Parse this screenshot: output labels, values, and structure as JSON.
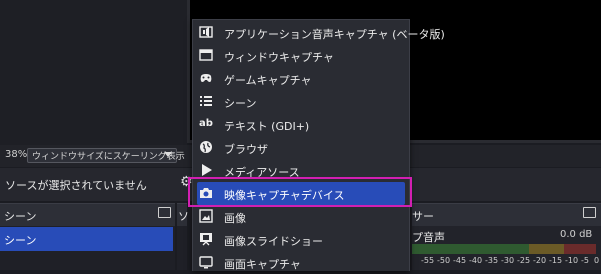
{
  "scale_bar": {
    "zoom": "38%",
    "mode": "ウィンドウサイズにスケーリング表示"
  },
  "source_bar": {
    "message": "ソースが選択されていません"
  },
  "scenes": {
    "title": "シーン",
    "items": [
      "シーン"
    ]
  },
  "sources": {
    "title_fragment": "ソ"
  },
  "mixer": {
    "title_fragment": "サー",
    "source_label": "プ音声",
    "level": "0.0 dB",
    "scale": [
      "-55",
      "-50",
      "-45",
      "-40",
      "-35",
      "-30",
      "-25",
      "-20",
      "-15",
      "-10",
      "-5",
      "0"
    ]
  },
  "menu": {
    "items": [
      {
        "label": "アプリケーション音声キャプチャ (ベータ版)",
        "icon": "app-audio-icon"
      },
      {
        "label": "ウィンドウキャプチャ",
        "icon": "window-icon"
      },
      {
        "label": "ゲームキャプチャ",
        "icon": "gamepad-icon"
      },
      {
        "label": "シーン",
        "icon": "list-icon"
      },
      {
        "label": "テキスト (GDI+)",
        "icon": "text-icon"
      },
      {
        "label": "ブラウザ",
        "icon": "globe-icon"
      },
      {
        "label": "メディアソース",
        "icon": "play-icon"
      },
      {
        "label": "映像キャプチャデバイス",
        "icon": "camera-icon",
        "selected": true
      },
      {
        "label": "画像",
        "icon": "image-icon"
      },
      {
        "label": "画像スライドショー",
        "icon": "slideshow-icon"
      },
      {
        "label": "画面キャプチャ",
        "icon": "monitor-icon"
      }
    ]
  },
  "colors": {
    "selection": "#284cb8",
    "highlight_box": "#d21fb2"
  }
}
